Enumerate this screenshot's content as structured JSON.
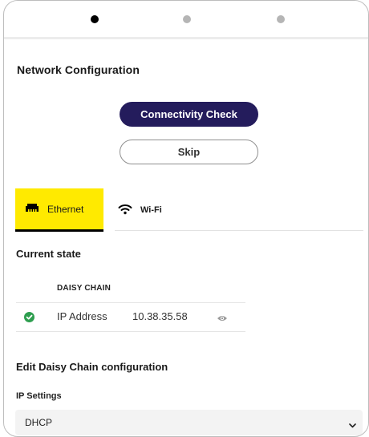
{
  "stepper": {
    "steps": 3,
    "active_step": 1
  },
  "page": {
    "title": "Network Configuration"
  },
  "actions": {
    "connectivity_check_label": "Connectivity Check",
    "skip_label": "Skip"
  },
  "tabs": [
    {
      "label": "Ethernet",
      "icon": "ethernet-icon",
      "selected": true
    },
    {
      "label": "Wi-Fi",
      "icon": "wifi-icon",
      "selected": false
    }
  ],
  "current_state": {
    "title": "Current state",
    "column_header": "DAISY CHAIN",
    "rows": [
      {
        "status_icon": "check-circle-icon",
        "label": "IP Address",
        "value": "10.38.35.58",
        "action_icon": "eye-icon"
      }
    ]
  },
  "edit": {
    "title": "Edit Daisy Chain configuration",
    "ip_settings_label": "IP Settings",
    "ip_settings_value": "DHCP"
  },
  "colors": {
    "primary_button": "#241c5c",
    "active_tab": "#ffea00",
    "success": "#2e9e4f"
  }
}
